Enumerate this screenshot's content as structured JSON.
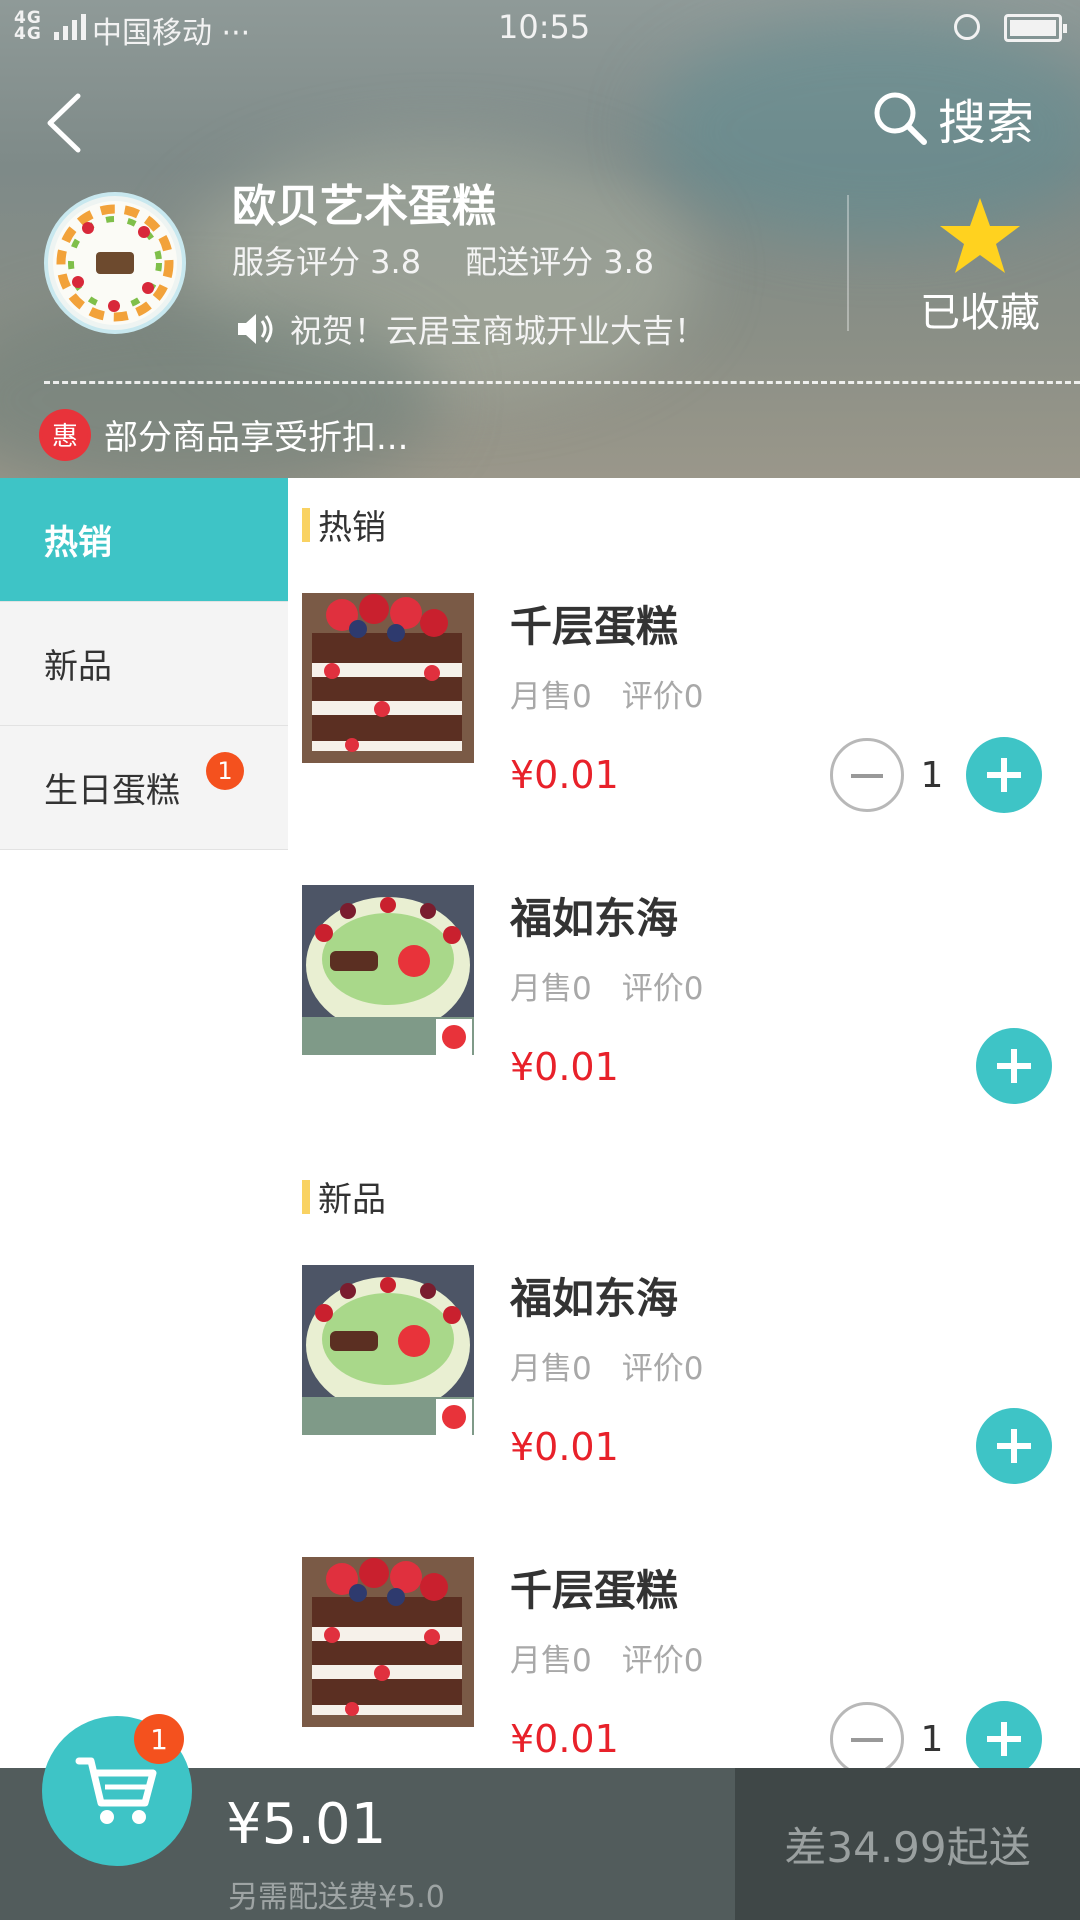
{
  "status_bar": {
    "network": "4G 4G",
    "carrier": "中国移动 ···",
    "time": "10:55"
  },
  "header": {
    "search_label": "搜索",
    "shop_name": "欧贝艺术蛋糕",
    "service_rating": "服务评分 3.8",
    "delivery_rating": "配送评分 3.8",
    "notice": "祝贺！云居宝商城开业大吉！",
    "favorite_label": "已收藏",
    "promo_badge": "惠",
    "promo_text": "部分商品享受折扣...",
    "icons": [
      "back-icon",
      "search-icon",
      "speaker-icon",
      "star-icon"
    ]
  },
  "sidebar": {
    "items": [
      {
        "label": "热销",
        "active": true
      },
      {
        "label": "新品",
        "active": false
      },
      {
        "label": "生日蛋糕",
        "active": false,
        "badge": "1"
      }
    ]
  },
  "sections": [
    {
      "title": "热销",
      "products": [
        {
          "name": "千层蛋糕",
          "monthly_sales": "月售0",
          "reviews": "评价0",
          "price": "¥0.01",
          "quantity": "1"
        },
        {
          "name": "福如东海",
          "monthly_sales": "月售0",
          "reviews": "评价0",
          "price": "¥0.01"
        }
      ]
    },
    {
      "title": "新品",
      "products": [
        {
          "name": "福如东海",
          "monthly_sales": "月售0",
          "reviews": "评价0",
          "price": "¥0.01"
        },
        {
          "name": "千层蛋糕",
          "monthly_sales": "月售0",
          "reviews": "评价0",
          "price": "¥0.01",
          "quantity": "1"
        }
      ]
    }
  ],
  "cart": {
    "badge": "1",
    "total": "¥5.01",
    "delivery_fee": "另需配送费¥5.0",
    "checkout_label": "差34.99起送"
  },
  "colors": {
    "accent": "#3ec4c6",
    "price": "#e8212a",
    "badge": "#f4511e",
    "section_marker": "#f9d262",
    "cart_bar": "#525c5c"
  }
}
